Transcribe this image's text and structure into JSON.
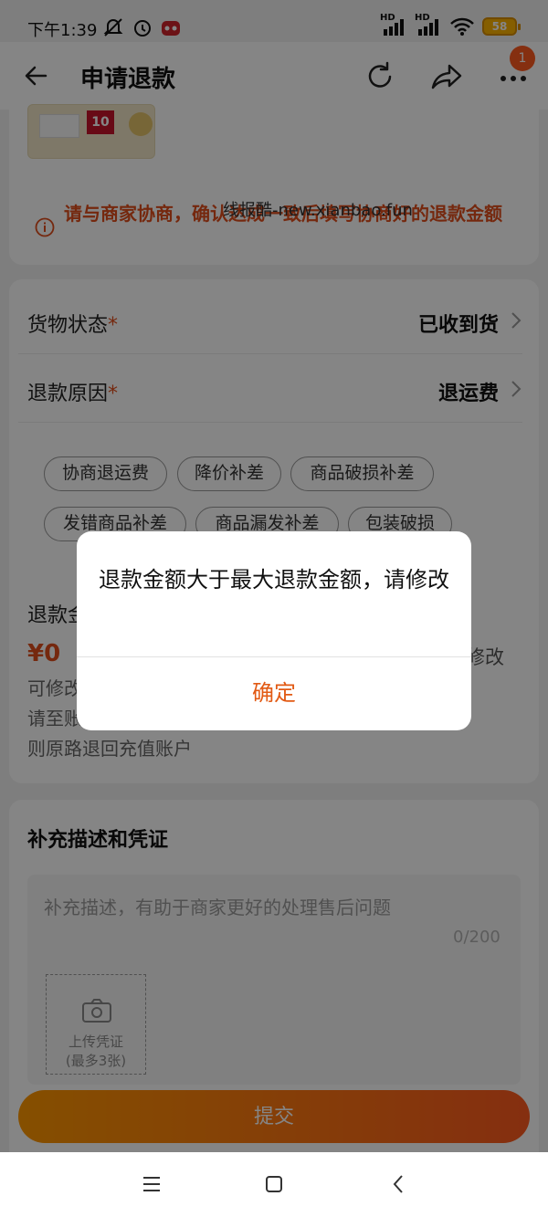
{
  "status_bar": {
    "time": "下午1:39",
    "network_labels": [
      "HD",
      "HD"
    ],
    "battery": "58",
    "left_icons": [
      "mute-icon",
      "alarm-icon",
      "app-notification-icon"
    ],
    "right_icons": [
      "signal-icon",
      "signal-icon",
      "wifi-icon",
      "battery-icon"
    ]
  },
  "header": {
    "title": "申请退款",
    "more_badge": "1",
    "icons": [
      "back-arrow-icon",
      "refresh-icon",
      "share-icon",
      "more-icon"
    ]
  },
  "product": {
    "tag_text": "10",
    "warning": "请与商家协商，确认达成一致后填写协商好的退款金额",
    "watermark": "线报酷-new.xianbao.fun"
  },
  "form": {
    "goods_status": {
      "label": "货物状态",
      "required_mark": "*",
      "value": "已收到货"
    },
    "refund_reason": {
      "label": "退款原因",
      "required_mark": "*",
      "value": "退运费"
    },
    "reason_chips": [
      "协商退运费",
      "降价补差",
      "商品破损补差",
      "发错商品补差",
      "商品漏发补差",
      "包装破损"
    ],
    "amount": {
      "label": "退款金额",
      "value": "¥0",
      "edit_label": "修改",
      "note_lines": [
        "可修改",
        "请至账",
        "则原路退回充值账户"
      ]
    }
  },
  "description": {
    "title": "补充描述和凭证",
    "placeholder": "补充描述，有助于商家更好的处理售后问题",
    "counter": "0/200",
    "upload_label": "上传凭证",
    "upload_hint": "(最多3张)"
  },
  "submit_label": "提交",
  "nav": {
    "icons": [
      "menu-icon",
      "home-icon",
      "back-icon"
    ]
  },
  "dialog": {
    "message": "退款金额大于最大退款金额，请修改",
    "confirm_label": "确定"
  },
  "colors": {
    "accent": "#ff5a1f",
    "warning_text": "#e04e1c",
    "dialog_confirm": "#e25a14",
    "overlay": "rgba(0,0,0,0.48)"
  }
}
